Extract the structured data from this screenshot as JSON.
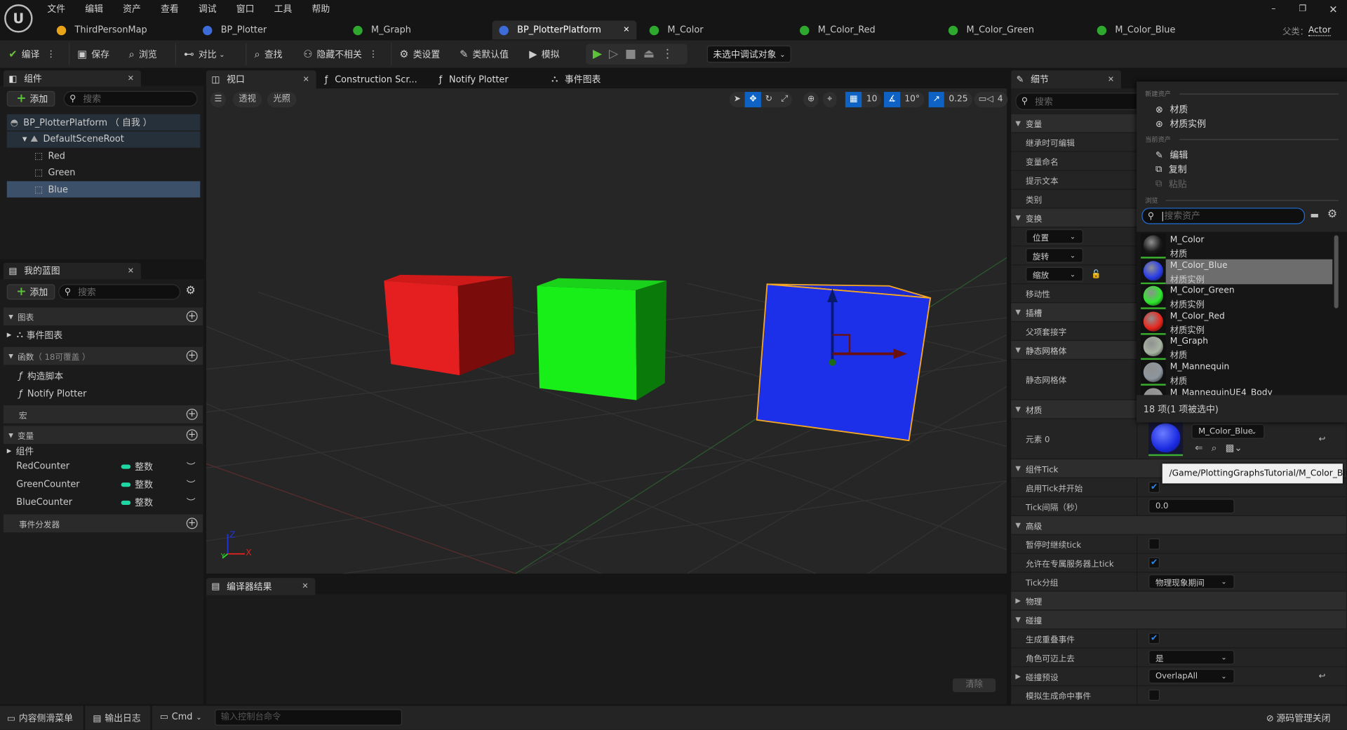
{
  "menu": [
    "文件",
    "编辑",
    "资产",
    "查看",
    "调试",
    "窗口",
    "工具",
    "帮助"
  ],
  "tabs": [
    {
      "label": "ThirdPersonMap",
      "icon": "map-icon",
      "color": "#e8a317"
    },
    {
      "label": "BP_Plotter",
      "icon": "blueprint-icon",
      "color": "#3d6bd8"
    },
    {
      "label": "M_Graph",
      "icon": "material-icon",
      "color": "#2fa82f"
    },
    {
      "label": "BP_PlotterPlatform",
      "icon": "blueprint-icon",
      "color": "#3d6bd8",
      "active": true
    },
    {
      "label": "M_Color",
      "icon": "material-icon",
      "color": "#2fa82f"
    },
    {
      "label": "M_Color_Red",
      "icon": "material-instance-icon",
      "color": "#2fa82f"
    },
    {
      "label": "M_Color_Green",
      "icon": "material-instance-icon",
      "color": "#2fa82f"
    },
    {
      "label": "M_Color_Blue",
      "icon": "material-instance-icon",
      "color": "#2fa82f"
    }
  ],
  "parent_class": {
    "label": "父类：",
    "value": "Actor"
  },
  "toolbar": {
    "compile": "编译",
    "save": "保存",
    "browse": "浏览",
    "diff": "对比",
    "find": "查找",
    "hide_unrelated": "隐藏不相关",
    "class_settings": "类设置",
    "class_defaults": "类默认值",
    "simulate": "模拟",
    "debug_target": "未选中调试对象"
  },
  "components": {
    "title": "组件",
    "add": "添加",
    "search_placeholder": "搜索",
    "tree": [
      {
        "label": "BP_PlotterPlatform （ 自我 ）",
        "level": 0
      },
      {
        "label": "DefaultSceneRoot",
        "level": 1
      },
      {
        "label": "Red",
        "level": 2
      },
      {
        "label": "Green",
        "level": 2
      },
      {
        "label": "Blue",
        "level": 2,
        "selected": true
      }
    ]
  },
  "my_blueprint": {
    "title": "我的蓝图",
    "add": "添加",
    "search_placeholder": "搜索",
    "graphs": "图表",
    "event_graph": "事件图表",
    "functions": "函数",
    "functions_note": "（ 18可覆盖 ）",
    "construction_script": "构造脚本",
    "notify_plotter": "Notify Plotter",
    "macros": "宏",
    "variables": "变量",
    "components_group": "组件",
    "vars": [
      {
        "name": "RedCounter",
        "type": "整数"
      },
      {
        "name": "GreenCounter",
        "type": "整数"
      },
      {
        "name": "BlueCounter",
        "type": "整数"
      }
    ],
    "dispatchers": "事件分发器",
    "var_type_color": "#1ed8a3"
  },
  "viewport_tabs": [
    "视口",
    "Construction Scr...",
    "Notify Plotter",
    "事件图表"
  ],
  "viewport": {
    "perspective": "透视",
    "lit": "光照",
    "grid_snap": "10",
    "rot_snap": "10°",
    "scale_snap": "0.25",
    "cam_speed": "4",
    "axis_x": "X",
    "axis_z": "Z",
    "axis_y": "Y"
  },
  "compiler": {
    "title": "编译器结果",
    "clear": "清除"
  },
  "details": {
    "title": "细节",
    "search_placeholder": "搜索",
    "rows": [
      {
        "label": "变量",
        "type": "header"
      },
      {
        "label": "继承时可编辑"
      },
      {
        "label": "变量命名"
      },
      {
        "label": "提示文本"
      },
      {
        "label": "类别"
      },
      {
        "label": "变换",
        "type": "header"
      },
      {
        "label": "位置",
        "type": "tcombo"
      },
      {
        "label": "旋转",
        "type": "tcombo"
      },
      {
        "label": "缩放",
        "type": "tcombo",
        "lock": true
      },
      {
        "label": "移动性"
      },
      {
        "label": "插槽",
        "type": "header"
      },
      {
        "label": "父项套接字"
      },
      {
        "label": "静态网格体",
        "type": "header"
      },
      {
        "label": "静态网格体",
        "type": "tall"
      },
      {
        "label": "材质",
        "type": "header"
      },
      {
        "label": "元素 0",
        "type": "material",
        "value": "M_Color_Blue"
      },
      {
        "label": "组件Tick",
        "type": "header"
      },
      {
        "label": "启用Tick并开始",
        "type": "check",
        "checked": true
      },
      {
        "label": "Tick间隔（秒）",
        "type": "input",
        "value": "0.0"
      },
      {
        "label": "高级",
        "type": "header"
      },
      {
        "label": "暂停时继续tick",
        "type": "check",
        "checked": false
      },
      {
        "label": "允许在专属服务器上tick",
        "type": "check",
        "checked": true
      },
      {
        "label": "Tick分组",
        "type": "combo",
        "value": "物理现象期间"
      },
      {
        "label": "物理",
        "type": "header",
        "collapsed": true
      },
      {
        "label": "碰撞",
        "type": "header"
      },
      {
        "label": "生成重叠事件",
        "type": "check",
        "checked": true
      },
      {
        "label": "角色可迈上去",
        "type": "combo",
        "value": "是"
      },
      {
        "label": "碰撞预设",
        "type": "combo",
        "value": "OverlapAll",
        "expander": true,
        "reset": true
      },
      {
        "label": "模拟生成命中事件",
        "type": "check",
        "checked": false
      }
    ]
  },
  "asset_picker": {
    "new_asset": "新建资产",
    "material": "材质",
    "material_instance": "材质实例",
    "current_asset": "当前资产",
    "edit": "编辑",
    "copy": "复制",
    "paste": "粘贴",
    "browse": "浏览",
    "search_placeholder": "搜索资产",
    "count": "18 项(1 项被选中)",
    "items": [
      {
        "name": "M_Color",
        "type": "材质",
        "color": "#1a1a1a"
      },
      {
        "name": "M_Color_Blue",
        "type": "材质实例",
        "color": "#2a3de8",
        "selected": true
      },
      {
        "name": "M_Color_Green",
        "type": "材质实例",
        "color": "#2fe82f"
      },
      {
        "name": "M_Color_Red",
        "type": "材质实例",
        "color": "#e8261e"
      },
      {
        "name": "M_Graph",
        "type": "材质",
        "color": "#a7b3a2"
      },
      {
        "name": "M_Mannequin",
        "type": "材质",
        "color": "#8d969e"
      },
      {
        "name": "M_MannequinUE4_Body",
        "type": "",
        "color": "#999999"
      }
    ]
  },
  "tooltip": "/Game/PlottingGraphsTutorial/M_Color_Blue",
  "statusbar": {
    "content_drawer": "内容侧滑菜单",
    "output_log": "输出日志",
    "cmd": "Cmd",
    "console_placeholder": "输入控制台命令",
    "source_control": "源码管理关闭"
  }
}
